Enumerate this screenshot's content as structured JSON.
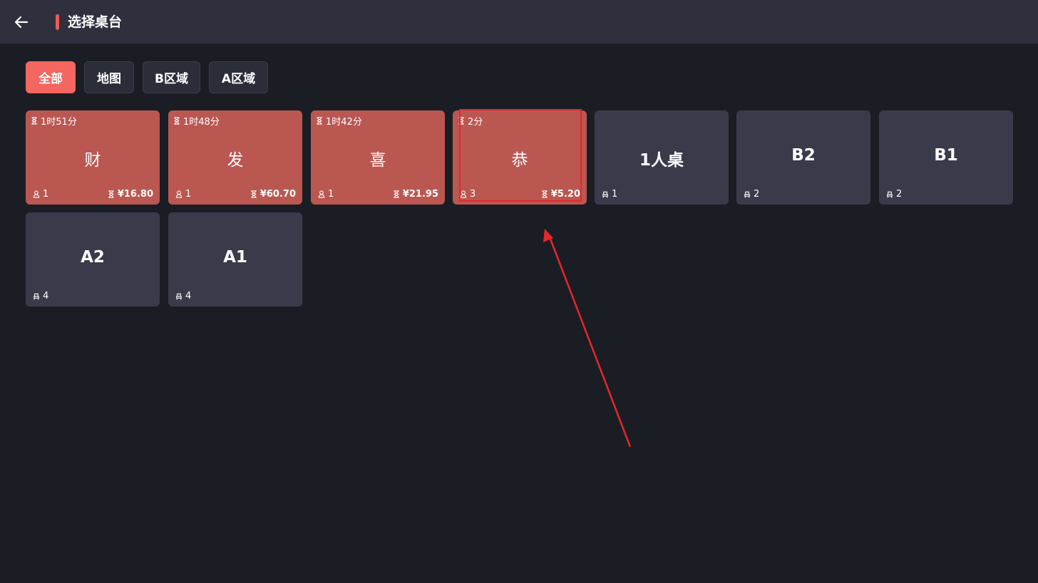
{
  "header": {
    "title": "选择桌台",
    "back_icon": "arrow-left-icon"
  },
  "tabs": [
    {
      "label": "全部",
      "active": true
    },
    {
      "label": "地图",
      "active": false
    },
    {
      "label": "B区域",
      "active": false
    },
    {
      "label": "A区域",
      "active": false
    }
  ],
  "tables": [
    {
      "name": "财",
      "status": "occupied",
      "time": "1时51分",
      "guests": "1",
      "amount": "¥16.80"
    },
    {
      "name": "发",
      "status": "occupied",
      "time": "1时48分",
      "guests": "1",
      "amount": "¥60.70"
    },
    {
      "name": "喜",
      "status": "occupied",
      "time": "1时42分",
      "guests": "1",
      "amount": "¥21.95"
    },
    {
      "name": "恭",
      "status": "occupied",
      "time": "2分",
      "guests": "3",
      "amount": "¥5.20"
    },
    {
      "name": "1人桌",
      "status": "free",
      "seats": "1"
    },
    {
      "name": "B2",
      "status": "free",
      "seats": "2"
    },
    {
      "name": "B1",
      "status": "free",
      "seats": "2"
    },
    {
      "name": "A2",
      "status": "free",
      "seats": "4"
    },
    {
      "name": "A1",
      "status": "free",
      "seats": "4"
    }
  ],
  "colors": {
    "background": "#1b1d25",
    "header": "#2e303e",
    "accent": "#f4665f",
    "occupied_card": "#bb5751",
    "free_card": "#393b4a",
    "annotation": "#e8262a"
  }
}
